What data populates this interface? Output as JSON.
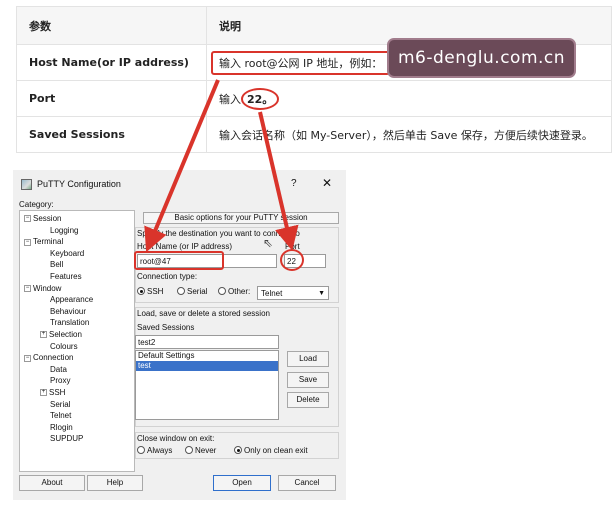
{
  "table": {
    "header": {
      "param": "参数",
      "desc": "说明"
    },
    "rows": [
      {
        "key": "Host Name(or IP address)",
        "desc_highlight": "输入 root@公网 IP 地址，例如：",
        "desc_tail": ""
      },
      {
        "key": "Port",
        "desc_pre": "输入",
        "desc_highlight": "22。"
      },
      {
        "key": "Saved Sessions",
        "desc": "输入会话名称（如 My-Server），然后单击 Save 保存，方便后续快速登录。"
      }
    ]
  },
  "watermark": "m6-denglu.com.cn",
  "window": {
    "title": "PuTTY Configuration",
    "help_glyph": "?",
    "close_glyph": "✕",
    "category_label": "Category:",
    "tree": [
      {
        "label": "Session",
        "level": "l0",
        "expander": "−"
      },
      {
        "label": "Logging",
        "level": "l1leaf"
      },
      {
        "label": "Terminal",
        "level": "l0",
        "expander": "−"
      },
      {
        "label": "Keyboard",
        "level": "l1leaf"
      },
      {
        "label": "Bell",
        "level": "l1leaf"
      },
      {
        "label": "Features",
        "level": "l1leaf"
      },
      {
        "label": "Window",
        "level": "l0",
        "expander": "−"
      },
      {
        "label": "Appearance",
        "level": "l1leaf"
      },
      {
        "label": "Behaviour",
        "level": "l1leaf"
      },
      {
        "label": "Translation",
        "level": "l1leaf"
      },
      {
        "label": "Selection",
        "level": "l1",
        "expander": "+"
      },
      {
        "label": "Colours",
        "level": "l1leaf"
      },
      {
        "label": "Connection",
        "level": "l0",
        "expander": "−"
      },
      {
        "label": "Data",
        "level": "l1leaf"
      },
      {
        "label": "Proxy",
        "level": "l1leaf"
      },
      {
        "label": "SSH",
        "level": "l1",
        "expander": "+"
      },
      {
        "label": "Serial",
        "level": "l1leaf"
      },
      {
        "label": "Telnet",
        "level": "l1leaf"
      },
      {
        "label": "Rlogin",
        "level": "l1leaf"
      },
      {
        "label": "SUPDUP",
        "level": "l1leaf"
      }
    ],
    "panel_title": "Basic options for your PuTTY session",
    "destination_label": "Specify the destination you want to connect to",
    "host_label": "Host Name (or IP address)",
    "host_value": "root@47",
    "port_label": "Port",
    "port_value": "22",
    "conn_type_label": "Connection type:",
    "conn_types": [
      "SSH",
      "Serial",
      "Other:"
    ],
    "other_protocol": "Telnet",
    "sessions_group_label": "Load, save or delete a stored session",
    "saved_sessions_label": "Saved Sessions",
    "saved_sessions_input": "test2",
    "sessions": [
      "Default Settings",
      "test"
    ],
    "load_btn": "Load",
    "save_btn": "Save",
    "delete_btn": "Delete",
    "close_on_exit_label": "Close window on exit:",
    "exit_options": [
      "Always",
      "Never",
      "Only on clean exit"
    ],
    "about_btn": "About",
    "help_btn": "Help",
    "open_btn": "Open",
    "cancel_btn": "Cancel"
  },
  "colors": {
    "annotation_red": "#d9342b",
    "selection_blue": "#3a72c9",
    "watermark_bg": "#6b4a58"
  }
}
